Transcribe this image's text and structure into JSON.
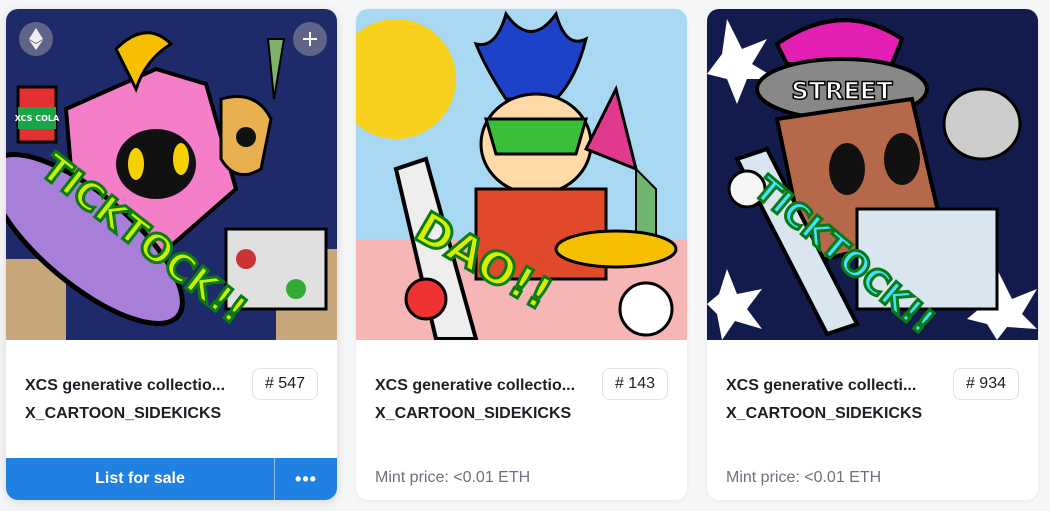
{
  "cards": [
    {
      "title": "XCS generative collectio...",
      "collection": "X_CARTOON_SIDEKICKS",
      "token_label": "# 547",
      "art_word": "TICKTOCK!!",
      "art_tag": "XCS COLA",
      "eth_icon": "ethereum-icon",
      "plus_icon": "plus-icon",
      "list_label": "List for sale",
      "more_label": "•••"
    },
    {
      "title": "XCS generative collectio...",
      "collection": "X_CARTOON_SIDEKICKS",
      "token_label": "# 143",
      "art_word": "DAO!!",
      "mint_price": "Mint price: <0.01 ETH"
    },
    {
      "title": "XCS generative collecti...",
      "collection": "X_CARTOON_SIDEKICKS",
      "token_label": "# 934",
      "art_word": "TICKTOCK!!",
      "art_tag": "STREET",
      "mint_price": "Mint price: <0.01 ETH"
    }
  ],
  "colors": {
    "accent": "#2081e2",
    "card_bg": "#ffffff",
    "page_bg": "#f5f6f8"
  }
}
